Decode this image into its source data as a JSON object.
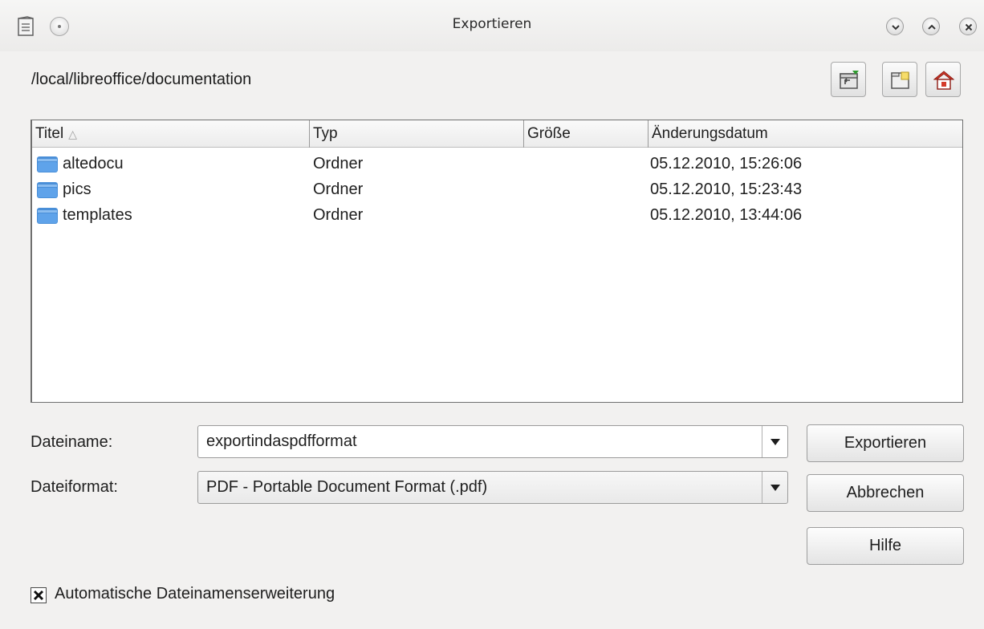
{
  "window": {
    "title": "Exportieren"
  },
  "path": "/local/libreoffice/documentation",
  "toolbar": {
    "up_icon": "folder-up-icon",
    "new_folder_icon": "new-folder-icon",
    "home_icon": "home-icon"
  },
  "filelist": {
    "columns": [
      "Titel",
      "Typ",
      "Größe",
      "Änderungsdatum"
    ],
    "sort_indicator": "△",
    "rows": [
      {
        "name": "altedocu",
        "type": "Ordner",
        "size": "",
        "date": "05.12.2010, 15:26:06"
      },
      {
        "name": "pics",
        "type": "Ordner",
        "size": "",
        "date": "05.12.2010, 15:23:43"
      },
      {
        "name": "templates",
        "type": "Ordner",
        "size": "",
        "date": "05.12.2010, 13:44:06"
      }
    ]
  },
  "form": {
    "filename_label": "Dateiname:",
    "filename_value": "exportindaspdfformat",
    "format_label": "Dateiformat:",
    "format_value": "PDF - Portable Document Format (.pdf)"
  },
  "buttons": {
    "export": "Exportieren",
    "cancel": "Abbrechen",
    "help": "Hilfe"
  },
  "options": {
    "auto_extension_label": "Automatische Dateinamenserweiterung",
    "auto_extension_checked": true
  },
  "colors": {
    "folder": "#4a8fd8",
    "home_roof": "#d43b2b"
  }
}
